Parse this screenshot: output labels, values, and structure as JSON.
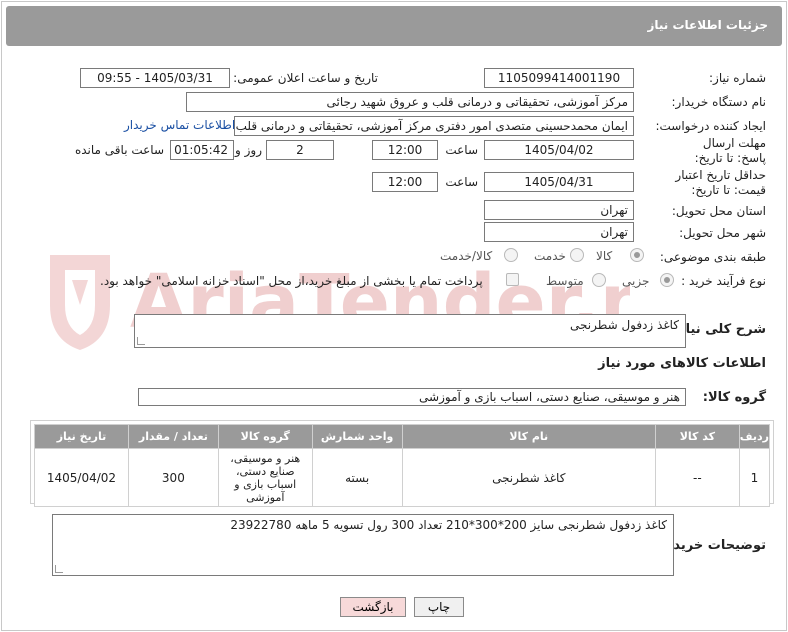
{
  "header": {
    "title": "جزئیات اطلاعات نیاز"
  },
  "labels": {
    "need_number": "شماره نیاز:",
    "announce_datetime": "تاریخ و ساعت اعلان عمومی:",
    "buyer_org": "نام دستگاه خریدار:",
    "requester": "ایجاد کننده درخواست:",
    "reply_deadline": "مهلت ارسال پاسخ: تا تاریخ:",
    "price_validity": "حداقل تاریخ اعتبار قیمت: تا تاریخ:",
    "time": "ساعت",
    "day_and": "روز و",
    "time_left": "ساعت باقی مانده",
    "province": "استان محل تحویل:",
    "city": "شهر محل تحویل:",
    "category": "طبقه بندی موضوعی:",
    "process_type": "نوع فرآیند خرید :",
    "general_desc": "شرح کلی نیاز:",
    "goods_info": "اطلاعات کالاهای مورد نیاز",
    "goods_group": "گروه کالا:",
    "buyer_notes": "توضیحات خریدار:"
  },
  "values": {
    "need_number": "1105099414001190",
    "announce_datetime": "1405/03/31 - 09:55",
    "buyer_org": "مرکز آموزشی، تحقیقاتی و درمانی قلب و عروق شهید رجائی",
    "requester": "ایمان محمدحسینی متصدی امور دفتری مرکز آموزشی، تحقیقاتی و درمانی قلب",
    "contact_link": "اطلاعات تماس خریدار",
    "reply_date": "1405/04/02",
    "reply_time": "12:00",
    "days": "2",
    "remaining": "01:05:42",
    "price_date": "1405/04/31",
    "price_time": "12:00",
    "province": "تهران",
    "city": "تهران",
    "general_desc": "کاغذ زدفول شطرنجی",
    "goods_group": "هنر و موسیقی، صنایع دستی، اسباب بازی و آموزشی",
    "buyer_notes": "کاغذ زدفول شطرنجی سایز 200*300*210 تعداد 300 رول تسویه 5 ماهه 23922780"
  },
  "category_options": {
    "goods": "کالا",
    "service": "خدمت",
    "goods_service": "کالا/خدمت",
    "selected": "کالا"
  },
  "process_options": {
    "partial": "جزیی",
    "medium": "متوسط",
    "payment_note": "پرداخت تمام یا بخشی از مبلغ خرید،از محل \"اسناد خزانه اسلامی\" خواهد بود.",
    "selected": "جزیی"
  },
  "table": {
    "headers": [
      "ردیف",
      "کد کالا",
      "نام کالا",
      "واحد شمارش",
      "گروه کالا",
      "تعداد / مقدار",
      "تاریخ نیاز"
    ],
    "rows": [
      [
        "1",
        "--",
        "کاغذ شطرنجی",
        "بسته",
        "هنر و موسیقی، صنایع دستی، اسباب بازی و آموزشی",
        "300",
        "1405/04/02"
      ]
    ]
  },
  "buttons": {
    "print": "چاپ",
    "back": "بازگشت"
  },
  "watermark": {
    "text": "AriaTender.neT"
  },
  "colors": {
    "header_bg": "#9a9a9a",
    "link": "#1a4fa3",
    "watermark": "#f3d6d6",
    "back_button": "#f7d9d9"
  }
}
